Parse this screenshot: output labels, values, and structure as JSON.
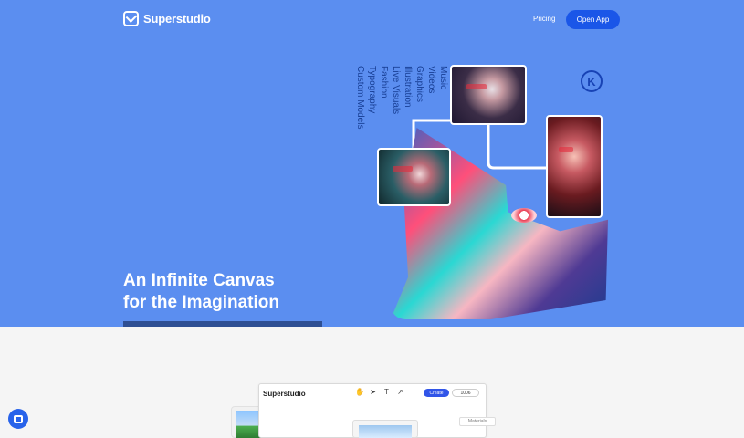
{
  "nav": {
    "brand": "Superstudio",
    "pricing": "Pricing",
    "open_app": "Open App"
  },
  "hero": {
    "title_line1": "An Infinite Canvas",
    "title_line2": "for the Imagination",
    "genres": [
      "Custom Models",
      "Typography",
      "Fashion",
      "Live Visuals",
      "Illustration",
      "Graphics",
      "Videos",
      "Music"
    ],
    "badge": "K"
  },
  "preview": {
    "brand": "Superstudio",
    "create_label": "Create",
    "credits": "1006",
    "materials": "Materials",
    "tools": [
      "hand-icon",
      "pointer-icon",
      "text-icon",
      "share-icon"
    ]
  }
}
